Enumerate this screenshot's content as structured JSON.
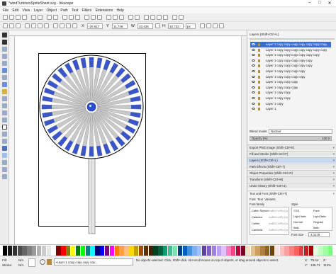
{
  "window": {
    "title": "*windTurbinesSpriteSheet.svg - Inkscape",
    "controls": [
      "–",
      "□",
      "✕"
    ]
  },
  "menu": [
    "File",
    "Edit",
    "View",
    "Layer",
    "Object",
    "Path",
    "Text",
    "Filters",
    "Extensions",
    "Help"
  ],
  "controls": {
    "x_label": "X:",
    "x_value": "-20.617",
    "y_label": "Y:",
    "y_value": "11.749",
    "w_label": "W:",
    "w_value": "33.426",
    "h_label": "H:",
    "h_value": "10.733",
    "units": "px"
  },
  "layers_panel": {
    "title": "Layers (Shift+Ctrl+L)",
    "rows": [
      "Layer 1 copy copy copy copy copy copy copy",
      "Layer 1 copy copy copy copy copy copy copy",
      "Layer 1 copy copy copy copy copy copy",
      "Layer 1 copy copy copy copy copy",
      "Layer 1 copy copy copy copy copy",
      "Layer 1 copy copy copy copy",
      "Layer 1 copy copy copy copy",
      "Layer 1 copy copy copy",
      "Layer 1 copy copy copy",
      "Layer 1 copy copy",
      "Layer 1 copy copy",
      "Layer 1 copy",
      "Layer 1"
    ],
    "blend_label": "Blend mode:",
    "blend_value": "Normal",
    "opacity_label": "Opacity (%)",
    "opacity_value": "100.0"
  },
  "docks": [
    "Export PNG Image (Shift+Ctrl+E)",
    "Fill and Stroke (Shift+Ctrl+F)",
    "Layers (Shift+Ctrl+L)",
    "Path Effects  (Shift+Ctrl+7)",
    "Object Properties (Shift+Ctrl+O)",
    "Transform (Shift+Ctrl+M)",
    "Undo History (Shift+Ctrl+Z)",
    "Text and Font (Shift+Ctrl+T)"
  ],
  "text_font": {
    "tabs": [
      "Font",
      "Text",
      "Variants"
    ],
    "family_label": "Font family",
    "style_label": "Style",
    "families": [
      "Cabin Sketch",
      "Caladea",
      "Calibri",
      "Cambria"
    ],
    "family_samples": [
      "AaBbCcIiPpQq",
      "AaBbCcIiPpQq",
      "AaBbCcIiPpQq",
      "AaBbCcIiPpQq"
    ],
    "styles_left": [
      "CSS",
      "Light Italic",
      "Normal",
      "Italic"
    ],
    "styles_right": [
      "Face",
      "Light Italic",
      "Regular",
      "Italic"
    ],
    "size_label": "Font size",
    "size_value": "2.4178"
  },
  "status": {
    "fill_label": "Fill:",
    "fill_value": "N/A",
    "stroke_label": "Stroke:",
    "stroke_value": "N/A",
    "layer_select": "•Layer 1 copy copy copy cop...",
    "message": "No objects selected. Click, Shift+click, Alt+scroll mouse on top of objects, or drag around objects to select.",
    "x_label": "X:",
    "x_value": "79.44",
    "y_label": "Y:",
    "y_value": "136.71",
    "zoom_label": "Z:",
    "zoom_value": "112%"
  },
  "colors": {
    "accent": "#2f5fd0",
    "blade_tip": "#3a55c8",
    "blade": "#c8c8c8"
  },
  "palette": [
    "#000000",
    "#1a1a1a",
    "#333333",
    "#4d4d4d",
    "#666666",
    "#808080",
    "#999999",
    "#b3b3b3",
    "#cccccc",
    "#e6e6e6",
    "#ffffff",
    "#800000",
    "#ff0000",
    "#808000",
    "#ffff00",
    "#008000",
    "#00ff00",
    "#008080",
    "#00ffff",
    "#000080",
    "#0000ff",
    "#800080",
    "#ff00ff",
    "#ff7f00",
    "#ff9f40",
    "#ffbf80",
    "#ffd700",
    "#c0a000",
    "#a05000",
    "#603000",
    "#402000",
    "#004020",
    "#006040",
    "#00a070",
    "#40c090",
    "#80e0b0",
    "#004080",
    "#0060c0",
    "#4090e0",
    "#80b0f0",
    "#a0c0ff",
    "#6040a0",
    "#8060c0",
    "#a080e0",
    "#c0a0ff",
    "#e0c0ff",
    "#ff80c0",
    "#ff4080",
    "#c00040",
    "#800020",
    "#f0e0c0",
    "#e0c090",
    "#d0a060",
    "#b08040",
    "#906020",
    "#704000",
    "#ffe0e0",
    "#ffc0c0",
    "#ffa0a0",
    "#ff8080",
    "#ff6060",
    "#e04040",
    "#c02020",
    "#a00000",
    "#e0ffe0",
    "#c0ffc0",
    "#a0ffa0",
    "#80ff80"
  ]
}
